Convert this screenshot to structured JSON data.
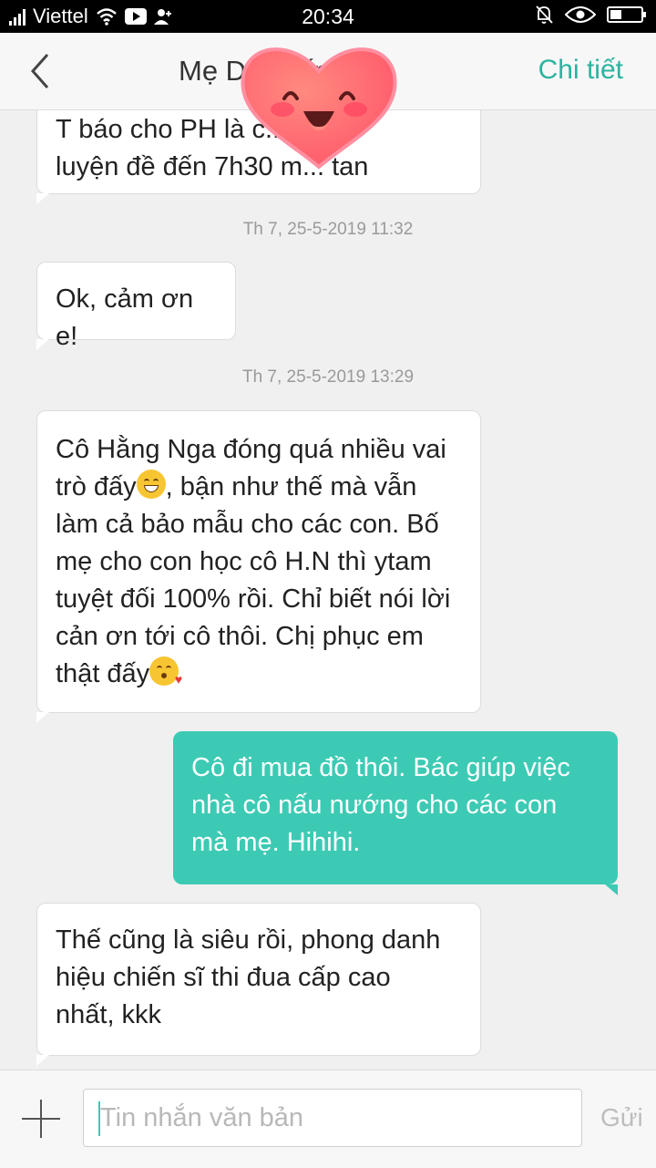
{
  "status_bar": {
    "carrier": "Viettel",
    "time": "20:34",
    "icons": [
      "signal-icon",
      "wifi-icon",
      "youtube-icon",
      "user-icon",
      "mute-bell-icon",
      "eye-icon",
      "battery-icon"
    ]
  },
  "header": {
    "back_icon": "chevron-left-icon",
    "title": "Mẹ D... Cấp ...",
    "detail_label": "Chi tiết"
  },
  "messages": [
    {
      "direction": "in",
      "lines": [
        "T báo cho PH là c... lại có",
        "luyện đề đến 7h30 m... tan"
      ]
    },
    {
      "timestamp": "Th 7, 25-5-2019  11:32"
    },
    {
      "direction": "in",
      "lines": [
        "Ok, cảm ơn e!"
      ]
    },
    {
      "timestamp": "Th 7, 25-5-2019  13:29"
    },
    {
      "direction": "in",
      "lines": [
        "Cô Hằng Nga đóng quá nhiều vai",
        "trò đấy",
        ", bận như thế mà vẫn",
        "làm cả bảo mẫu cho các con. Bố",
        "mẹ cho con học cô H.N thì ytam",
        "tuyệt đối 100% rồi. Chỉ biết nói lời",
        "cản ơn tới cô thôi. Chị phục em",
        "thật đấy"
      ]
    },
    {
      "direction": "out",
      "lines": [
        "Cô đi mua đồ thôi. Bác giúp việc",
        "nhà cô nấu nướng cho các con",
        "mà mẹ. Hihihi."
      ]
    },
    {
      "direction": "in",
      "lines": [
        "Thế cũng là siêu rồi, phong danh",
        "hiệu chiến sĩ thi đua cấp cao",
        "nhất, kkk"
      ]
    }
  ],
  "input_bar": {
    "placeholder": "Tin nhắn văn bản",
    "send_label": "Gửi",
    "add_icon": "plus-icon"
  },
  "colors": {
    "accent": "#2bb3a0",
    "outgoing_bubble": "#3dcab4",
    "incoming_bubble": "#ffffff",
    "background": "#f0f0f0"
  }
}
